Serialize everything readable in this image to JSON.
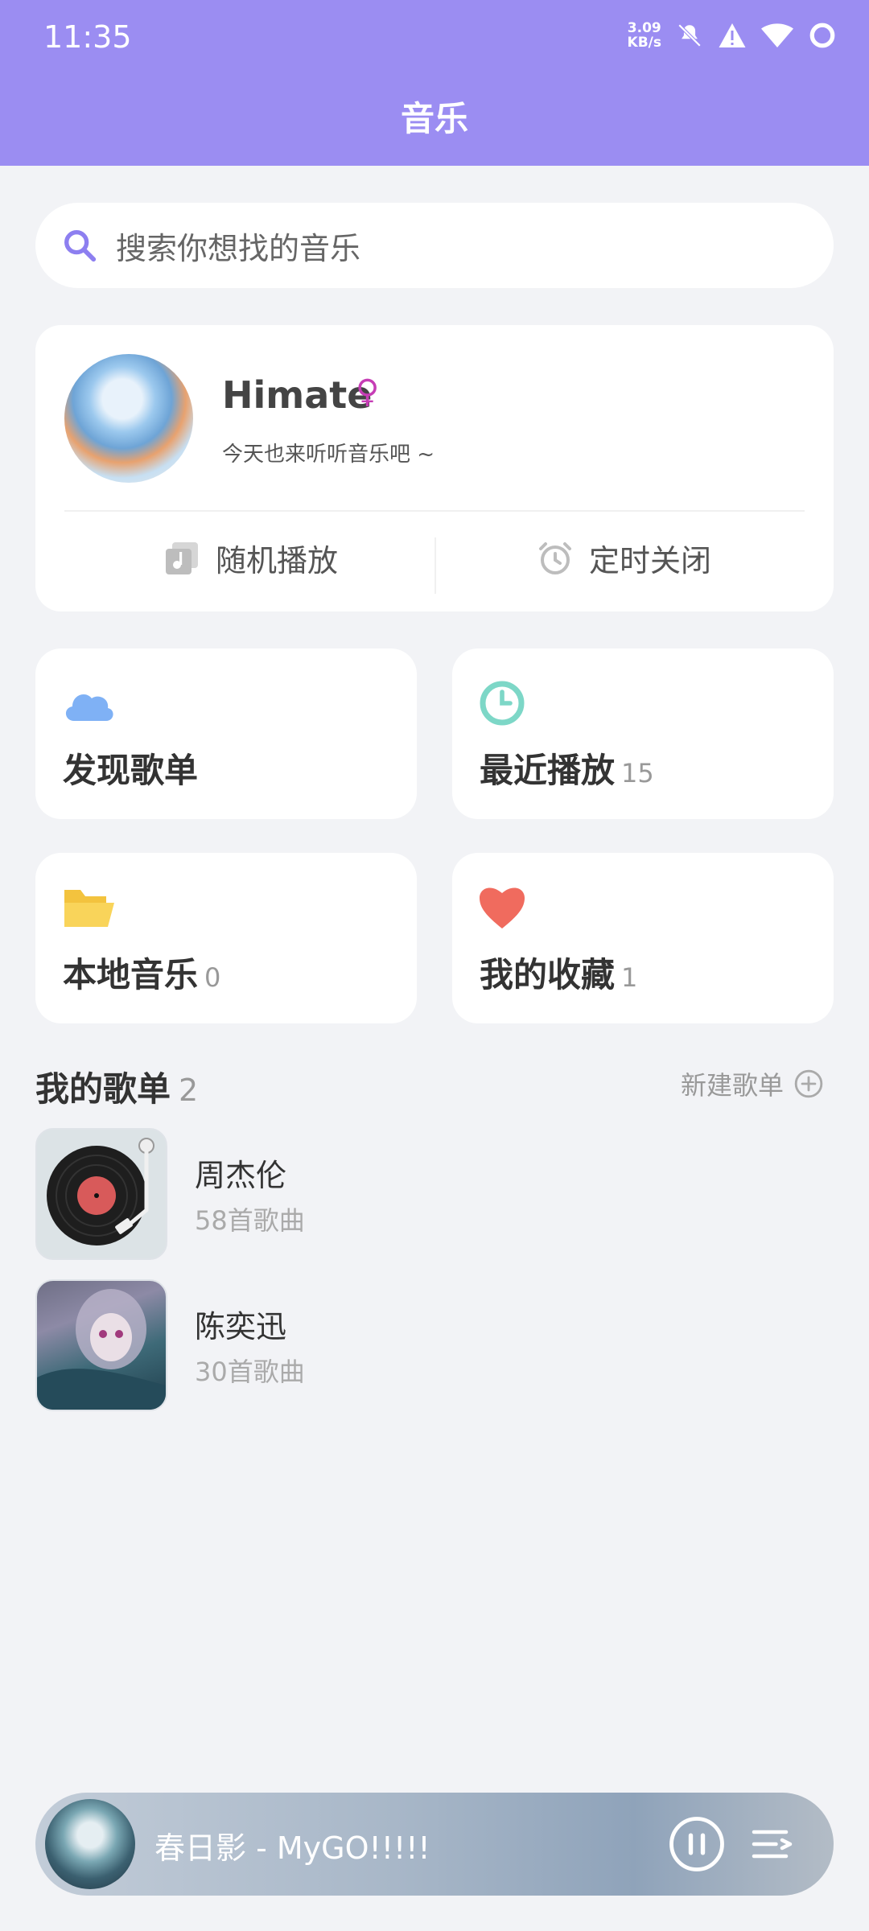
{
  "status_bar": {
    "time": "11:35",
    "net_speed_value": "3.09",
    "net_speed_unit": "KB/s"
  },
  "header": {
    "title": "音乐"
  },
  "search": {
    "placeholder": "搜索你想找的音乐",
    "icon": "search-icon"
  },
  "profile": {
    "username": "Himate",
    "gender_symbol": "♀",
    "motto": "今天也来听听音乐吧 ~",
    "actions": [
      {
        "label": "随机播放",
        "icon": "shuffle-play-icon"
      },
      {
        "label": "定时关闭",
        "icon": "alarm-clock-icon"
      }
    ]
  },
  "tiles": [
    {
      "label": "发现歌单",
      "count": "",
      "icon": "cloud-icon",
      "color": "#7fb1f5"
    },
    {
      "label": "最近播放",
      "count": "15",
      "icon": "clock-icon",
      "color": "#7dd7c7"
    },
    {
      "label": "本地音乐",
      "count": "0",
      "icon": "folder-icon",
      "color": "#f9d45a"
    },
    {
      "label": "我的收藏",
      "count": "1",
      "icon": "heart-icon",
      "color": "#f06b5e"
    }
  ],
  "my_playlists": {
    "title": "我的歌单",
    "count": "2",
    "new_label": "新建歌单",
    "items": [
      {
        "name": "周杰伦",
        "count_text": "58首歌曲"
      },
      {
        "name": "陈奕迅",
        "count_text": "30首歌曲"
      }
    ]
  },
  "now_playing": {
    "text": "春日影 - MyGO!!!!!"
  },
  "colors": {
    "accent": "#9b8df2",
    "background": "#f2f3f6"
  }
}
